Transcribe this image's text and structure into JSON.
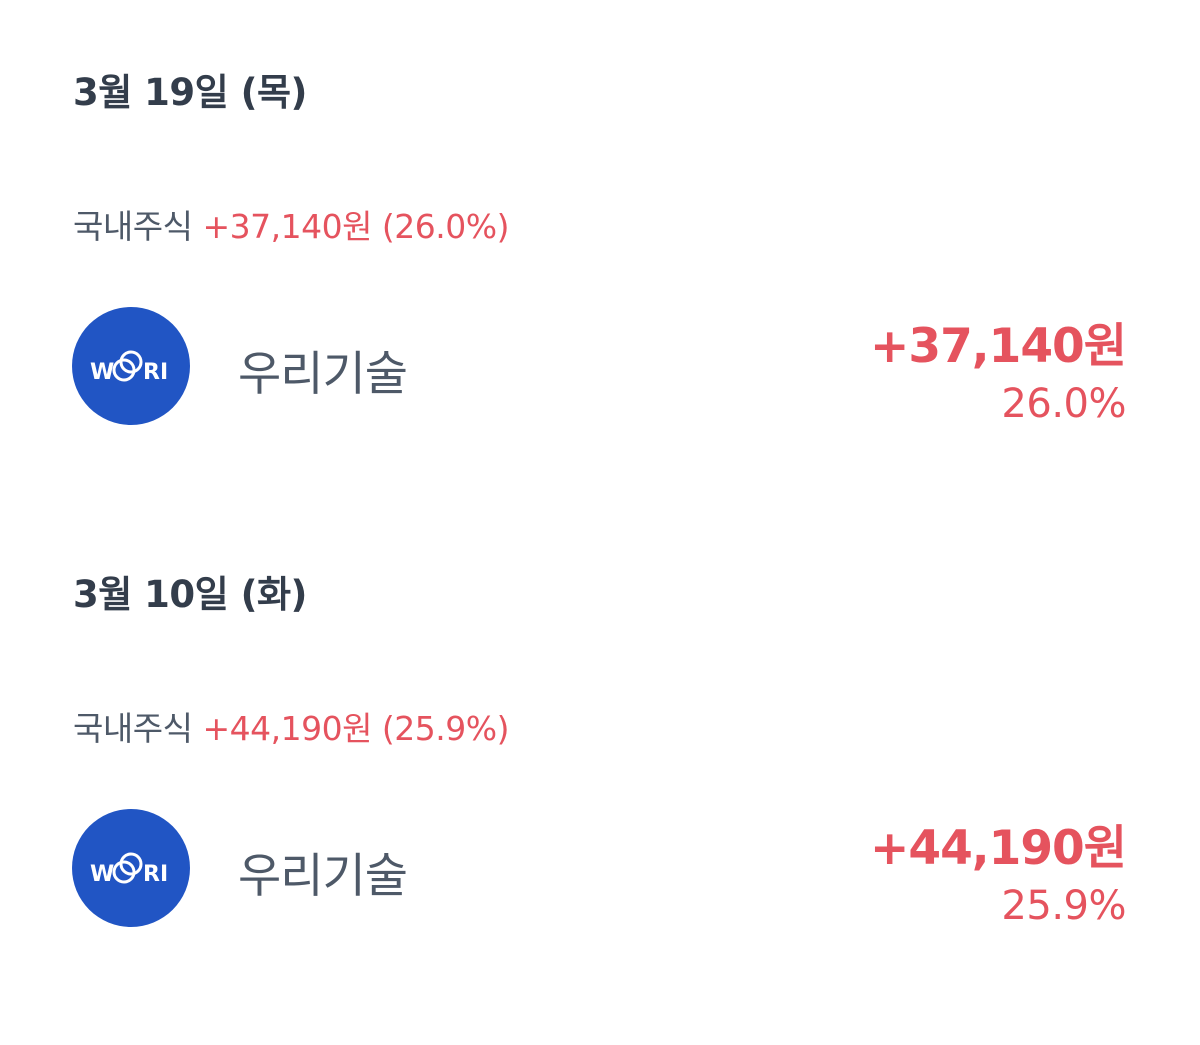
{
  "sections": [
    {
      "date": "3월 19일 (목)",
      "category": "국내주식",
      "summary_gain": "+37,140원 (26.0%)",
      "stock": {
        "logo_text_left": "W",
        "logo_text_right": "RI",
        "name": "우리기술",
        "amount": "+37,140원",
        "rate": "26.0%"
      }
    },
    {
      "date": "3월 10일 (화)",
      "category": "국내주식",
      "summary_gain": "+44,190원 (25.9%)",
      "stock": {
        "logo_text_left": "W",
        "logo_text_right": "RI",
        "name": "우리기술",
        "amount": "+44,190원",
        "rate": "25.9%"
      }
    }
  ],
  "colors": {
    "heading": "#333d4b",
    "secondary_text": "#4e5968",
    "gain_red": "#e5535e",
    "logo_blue": "#2155c4"
  },
  "icons": {
    "stock_logo": "wori-logo-icon"
  }
}
